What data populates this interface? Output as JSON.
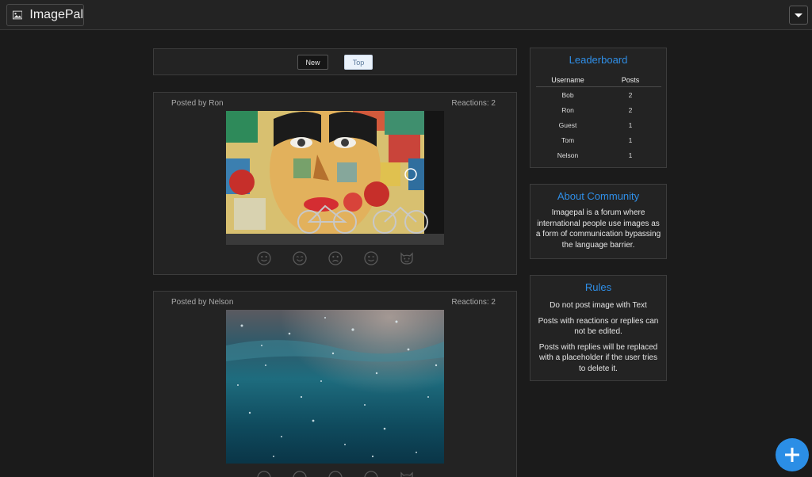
{
  "app": {
    "name": "ImagePal",
    "icon": "image-icon"
  },
  "header": {
    "menu_icon": "caret-down-icon"
  },
  "sort": {
    "new_label": "New",
    "top_label": "Top",
    "active": "Top"
  },
  "posts": [
    {
      "author_label": "Posted by Ron",
      "reactions_label": "Reactions: 2",
      "image": "street-art-mural-with-bicycles",
      "reaction_icons": [
        "smiley-icon",
        "smile-icon",
        "sad-icon",
        "wink-icon",
        "cat-icon"
      ]
    },
    {
      "author_label": "Posted by Nelson",
      "reactions_label": "Reactions: 2",
      "image": "underwater-ocean-surface",
      "reaction_icons": [
        "smiley-icon",
        "smile-icon",
        "sad-icon",
        "wink-icon",
        "cat-icon"
      ]
    }
  ],
  "leaderboard": {
    "title": "Leaderboard",
    "headers": {
      "username": "Username",
      "posts": "Posts"
    },
    "rows": [
      {
        "username": "Bob",
        "posts": "2"
      },
      {
        "username": "Ron",
        "posts": "2"
      },
      {
        "username": "Guest",
        "posts": "1"
      },
      {
        "username": "Tom",
        "posts": "1"
      },
      {
        "username": "Nelson",
        "posts": "1"
      }
    ]
  },
  "about": {
    "title": "About Community",
    "text": "Imagepal is a forum where international people use images as a form of communication bypassing the language barrier."
  },
  "rules": {
    "title": "Rules",
    "items": [
      "Do not post image with Text",
      "Posts with reactions or replies can not be edited.",
      "Posts with replies will be replaced with a placeholder if the user tries to delete it."
    ]
  },
  "fab": {
    "icon": "plus-icon"
  },
  "colors": {
    "accent": "#2f8fe8",
    "background": "#1b1b1b",
    "panel": "#232323"
  }
}
